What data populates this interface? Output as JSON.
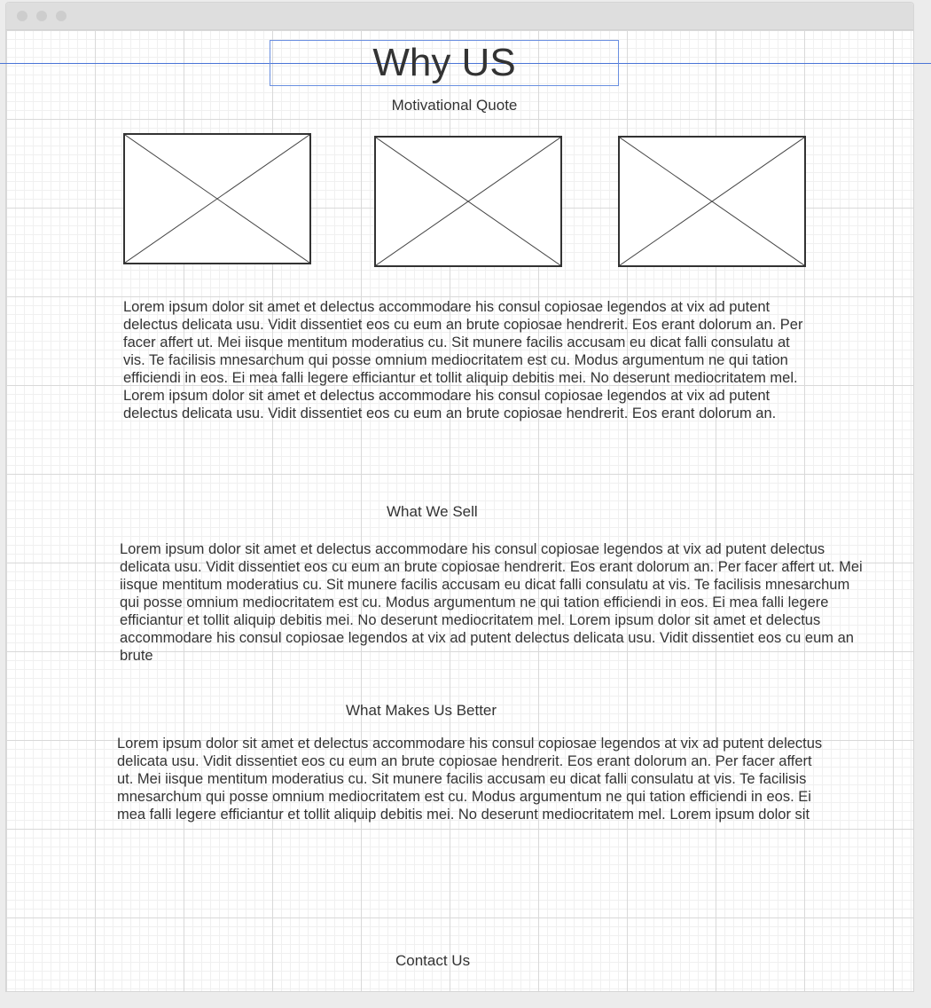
{
  "page": {
    "heading": "Why US",
    "subtitle": "Motivational Quote",
    "image_placeholder_icon": "image-placeholder-icon",
    "intro_text": "Lorem ipsum dolor sit amet et delectus accommodare his consul copiosae legendos at vix ad putent delectus delicata usu. Vidit dissentiet eos cu eum an brute copiosae hendrerit. Eos erant dolorum an. Per facer affert ut. Mei iisque mentitum moderatius cu. Sit munere facilis accusam eu dicat falli consulatu at vis. Te facilisis mnesarchum qui posse omnium mediocritatem est cu. Modus argumentum ne qui tation efficiendi in eos. Ei mea falli legere efficiantur et tollit aliquip debitis mei. No deserunt mediocritatem mel. Lorem ipsum dolor sit amet et delectus accommodare his consul copiosae legendos at vix ad putent delectus delicata usu. Vidit dissentiet eos cu eum an brute copiosae hendrerit. Eos erant dolorum an.",
    "sell_heading": "What We Sell",
    "sell_text": "Lorem ipsum dolor sit amet et delectus accommodare his consul copiosae legendos at vix ad putent delectus delicata usu. Vidit dissentiet eos cu eum an brute copiosae hendrerit. Eos erant dolorum an. Per facer affert ut. Mei iisque mentitum moderatius cu. Sit munere facilis accusam eu dicat falli consulatu at vis. Te facilisis mnesarchum qui posse omnium mediocritatem est cu. Modus argumentum ne qui tation efficiendi in eos. Ei mea falli legere efficiantur et tollit aliquip debitis mei. No deserunt mediocritatem mel. Lorem ipsum dolor sit amet et delectus accommodare his consul copiosae legendos at vix ad putent delectus delicata usu. Vidit dissentiet eos cu eum an brute",
    "better_heading": "What Makes Us Better",
    "better_text": "Lorem ipsum dolor sit amet et delectus accommodare his consul copiosae legendos at vix ad putent delectus delicata usu. Vidit dissentiet eos cu eum an brute copiosae hendrerit. Eos erant dolorum an. Per facer affert ut. Mei iisque mentitum moderatius cu. Sit munere facilis accusam eu dicat falli consulatu at vis. Te facilisis mnesarchum qui posse omnium mediocritatem est cu. Modus argumentum ne qui tation efficiendi in eos. Ei mea falli legere efficiantur et tollit aliquip debitis mei. No deserunt mediocritatem mel. Lorem ipsum dolor sit",
    "contact_label": "Contact Us"
  },
  "colors": {
    "guide": "#4a74d6",
    "selection": "#6a8fe0",
    "text": "#333333"
  }
}
